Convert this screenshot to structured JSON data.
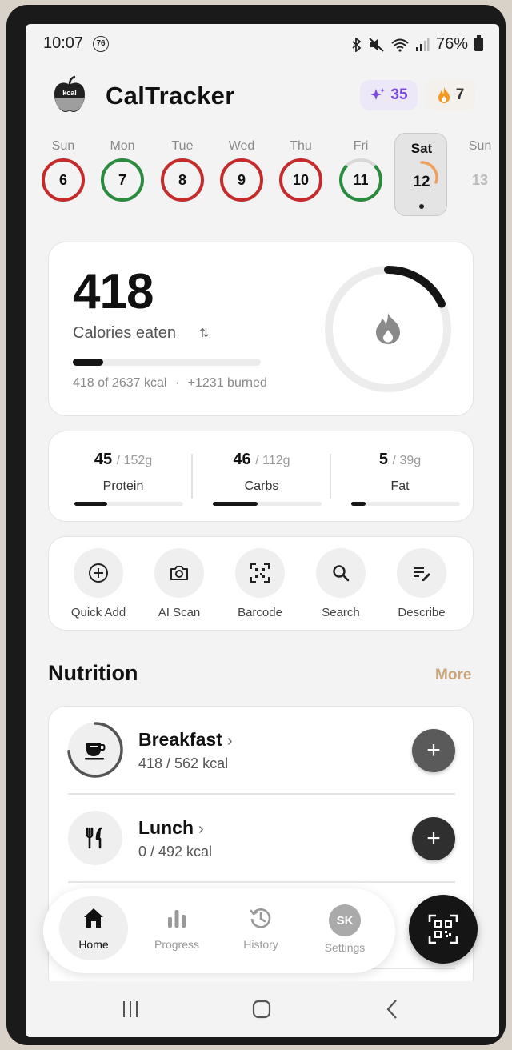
{
  "status": {
    "time": "10:07",
    "notif_count": "76",
    "battery": "76%"
  },
  "app": {
    "title": "CalTracker",
    "logo_label": "kcal",
    "sparkles": "35",
    "streak": "7"
  },
  "week": [
    {
      "name": "Sun",
      "num": "6",
      "status": "red"
    },
    {
      "name": "Mon",
      "num": "7",
      "status": "green"
    },
    {
      "name": "Tue",
      "num": "8",
      "status": "red"
    },
    {
      "name": "Wed",
      "num": "9",
      "status": "red"
    },
    {
      "name": "Thu",
      "num": "10",
      "status": "red"
    },
    {
      "name": "Fri",
      "num": "11",
      "status": "green-partial"
    }
  ],
  "selected_day": {
    "name": "Sat",
    "num": "12",
    "progress": 0.16
  },
  "next_day": {
    "name": "Sun",
    "num": "13"
  },
  "calories": {
    "eaten": "418",
    "label": "Calories eaten",
    "summary": "418 of 2637 kcal",
    "burned": "+1231 burned",
    "progress": 0.16,
    "ring_progress": 0.18
  },
  "macros": [
    {
      "value": "45",
      "goal": "/ 152g",
      "name": "Protein",
      "progress": 0.3
    },
    {
      "value": "46",
      "goal": "/ 112g",
      "name": "Carbs",
      "progress": 0.41
    },
    {
      "value": "5",
      "goal": "/ 39g",
      "name": "Fat",
      "progress": 0.13
    }
  ],
  "actions": [
    {
      "label": "Quick Add",
      "icon": "plus-circle-icon"
    },
    {
      "label": "AI Scan",
      "icon": "camera-icon"
    },
    {
      "label": "Barcode",
      "icon": "barcode-icon"
    },
    {
      "label": "Search",
      "icon": "search-icon"
    },
    {
      "label": "Describe",
      "icon": "edit-list-icon"
    }
  ],
  "nutrition": {
    "title": "Nutrition",
    "more": "More"
  },
  "meals": [
    {
      "name": "Breakfast",
      "kcal": "418 / 562 kcal",
      "progress": 0.74,
      "icon": "coffee-cup-icon"
    },
    {
      "name": "Lunch",
      "kcal": "0 / 492 kcal",
      "progress": 0,
      "icon": "fork-knife-icon"
    }
  ],
  "nav": [
    {
      "label": "Home",
      "icon": "home-icon",
      "active": true
    },
    {
      "label": "Progress",
      "icon": "bar-chart-icon"
    },
    {
      "label": "History",
      "icon": "history-icon"
    },
    {
      "label": "Settings",
      "avatar": "SK"
    }
  ]
}
